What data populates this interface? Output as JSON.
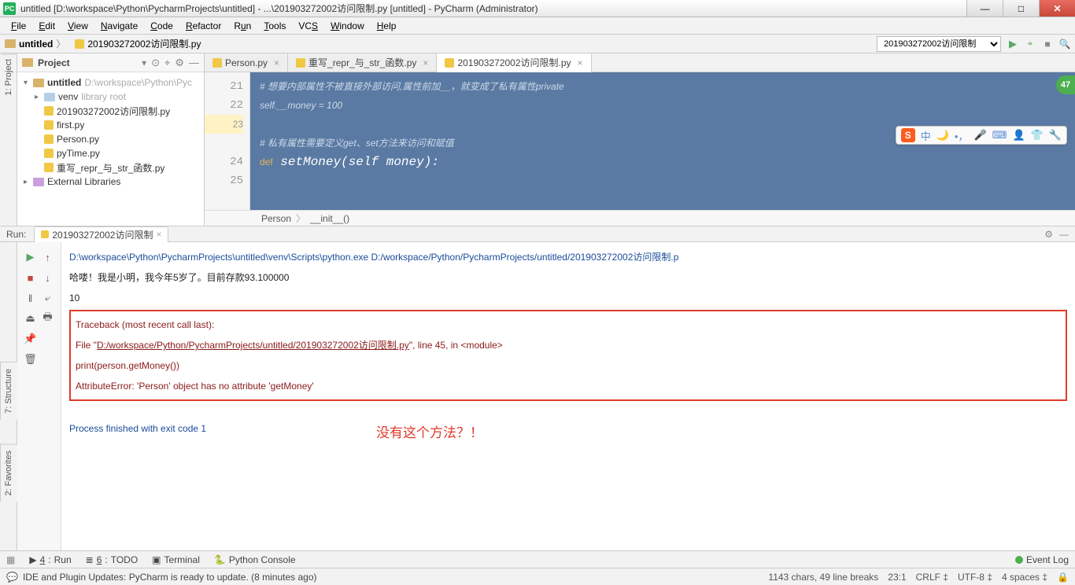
{
  "window": {
    "title": "untitled [D:\\workspace\\Python\\PycharmProjects\\untitled] - ...\\201903272002访问限制.py [untitled] - PyCharm (Administrator)"
  },
  "menu": [
    "File",
    "Edit",
    "View",
    "Navigate",
    "Code",
    "Refactor",
    "Run",
    "Tools",
    "VCS",
    "Window",
    "Help"
  ],
  "breadcrumb": {
    "root": "untitled",
    "file": "201903272002访问限制.py"
  },
  "runconfig": "201903272002访问限制",
  "badge": "47",
  "project": {
    "title": "Project",
    "items": [
      {
        "lvl": 0,
        "type": "folder",
        "chev": "▾",
        "name": "untitled",
        "hint": "D:\\workspace\\Python\\Pyc"
      },
      {
        "lvl": 1,
        "type": "folder-blue",
        "chev": "▸",
        "name": "venv",
        "hint": "library root"
      },
      {
        "lvl": 1,
        "type": "py",
        "name": "201903272002访问限制.py"
      },
      {
        "lvl": 1,
        "type": "py",
        "name": "first.py"
      },
      {
        "lvl": 1,
        "type": "py",
        "name": "Person.py"
      },
      {
        "lvl": 1,
        "type": "py",
        "name": "pyTime.py"
      },
      {
        "lvl": 1,
        "type": "py",
        "name": "重写_repr_与_str_函数.py"
      },
      {
        "lvl": 0,
        "type": "lib",
        "chev": "▸",
        "name": "External Libraries"
      }
    ]
  },
  "editor": {
    "tabs": [
      {
        "name": "Person.py"
      },
      {
        "name": "重写_repr_与_str_函数.py"
      },
      {
        "name": "201903272002访问限制.py",
        "active": true
      }
    ],
    "gutter": [
      "21",
      "22",
      "23",
      "24",
      "25"
    ],
    "lines": [
      "# 想要内部属性不被直接外部访问,属性前加__，就变成了私有属性private",
      "self.__money = 100",
      "",
      "# 私有属性需要定义get、set方法来访问和赋值",
      "def setMoney(self money):"
    ],
    "crumbs": [
      "Person",
      "__init__()"
    ]
  },
  "run": {
    "label": "Run:",
    "tab": "201903272002访问限制",
    "lines": {
      "cmd": "D:\\workspace\\Python\\PycharmProjects\\untitled\\venv\\Scripts\\python.exe D:/workspace/Python/PycharmProjects/untitled/201903272002访问限制.p",
      "out1": "哈喽！我是小明，我今年5岁了。目前存款93.100000",
      "out2": "10",
      "tb": "Traceback (most recent call last):",
      "file_pre": "  File \"",
      "file_link": "D:/workspace/Python/PycharmProjects/untitled/201903272002访问限制.py",
      "file_post": "\", line 45, in <module>",
      "call": "    print(person.getMoney())",
      "err": "AttributeError: 'Person' object has no attribute 'getMoney'",
      "exit": "Process finished with exit code 1"
    },
    "annotation": "没有这个方法？！"
  },
  "tools": [
    {
      "k": "4",
      "l": "Run"
    },
    {
      "k": "6",
      "l": "TODO"
    },
    {
      "k": "",
      "l": "Terminal"
    },
    {
      "k": "",
      "l": "Python Console"
    }
  ],
  "eventlog": "Event Log",
  "status": {
    "msg": "IDE and Plugin Updates: PyCharm is ready to update. (8 minutes ago)",
    "right": [
      "1143 chars, 49 line breaks",
      "23:1",
      "CRLF ‡",
      "UTF-8 ‡",
      "4 spaces ‡"
    ]
  },
  "sidetabs_top": [
    "1: Project"
  ],
  "sidetabs_bottom": [
    "7: Structure",
    "2: Favorites"
  ]
}
